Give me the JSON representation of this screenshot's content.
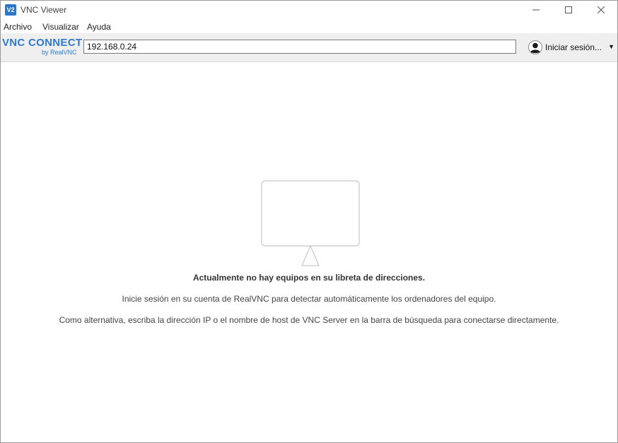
{
  "window": {
    "title": "VNC Viewer",
    "app_icon": "V2"
  },
  "menu": {
    "items": [
      "Archivo",
      "Visualizar",
      "Ayuda"
    ]
  },
  "toolbar": {
    "logo_main": "VNC CONNECT",
    "logo_sub": "by RealVNC",
    "address_value": "192.168.0.24",
    "signin_label": "Iniciar sesión..."
  },
  "content": {
    "title": "Actualmente no hay equipos en su libreta de direcciones.",
    "line1": "Inicie sesión en su cuenta de RealVNC para detectar automáticamente los ordenadores del equipo.",
    "line2": "Como alternativa, escriba la dirección IP o el nombre de host de VNC Server en la barra de búsqueda para conectarse directamente."
  },
  "colors": {
    "brand": "#2f7ad1",
    "toolbar_bg": "#efefef"
  },
  "icons": {
    "minimize": "minimize-icon",
    "maximize": "maximize-icon",
    "close": "close-icon",
    "user": "user-icon",
    "caret": "chevron-down-icon",
    "monitor": "monitor-icon"
  }
}
